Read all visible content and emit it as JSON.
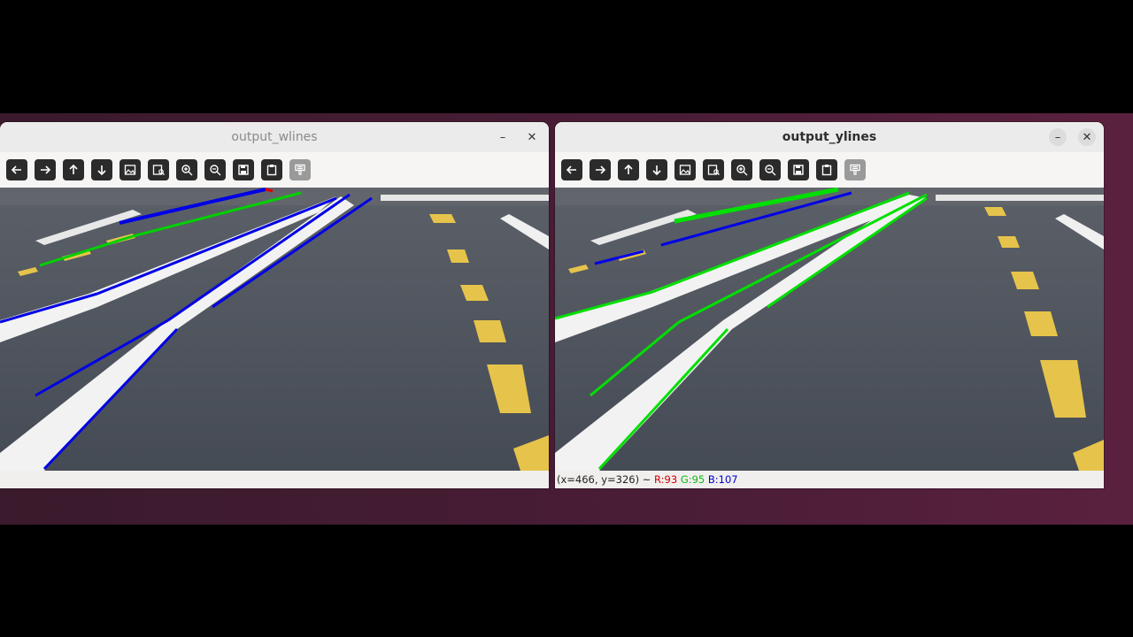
{
  "windows": [
    {
      "title": "output_wlines",
      "status": {
        "coord": "",
        "r": "",
        "g": "",
        "b": ""
      }
    },
    {
      "title": "output_ylines",
      "status": {
        "coord": "(x=466, y=326) ~",
        "r": "R:93",
        "g": "G:95",
        "b": "B:107"
      }
    }
  ],
  "toolbar_icons": [
    "arrow-left-icon",
    "arrow-right-icon",
    "arrow-up-icon",
    "arrow-down-icon",
    "image-icon",
    "image-search-icon",
    "zoom-in-icon",
    "zoom-out-icon",
    "save-icon",
    "clipboard-icon",
    "properties-icon"
  ],
  "colors": {
    "desktop": "#4a1d36",
    "road": "#444b55",
    "white_line_overlay": "#0000e6",
    "yellow_line_overlay": "#00e600",
    "lane_white": "#f2f2f2",
    "lane_yellow": "#e6c34a"
  }
}
